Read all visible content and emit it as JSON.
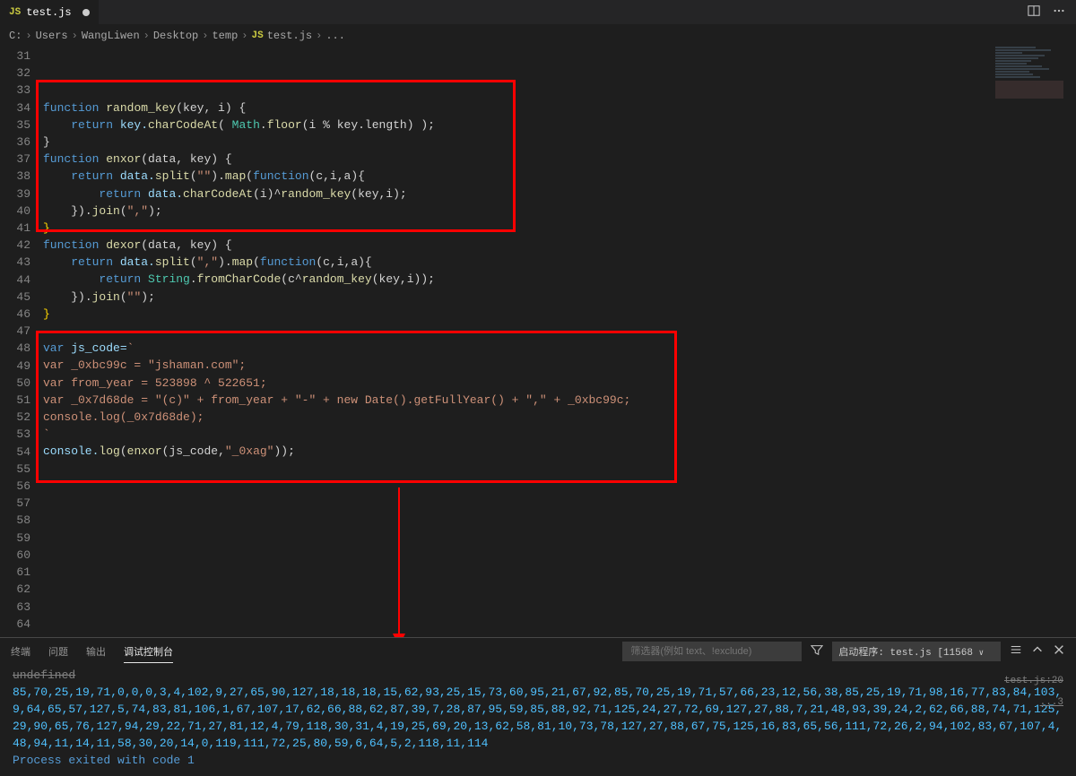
{
  "tab": {
    "icon": "JS",
    "filename": "test.js"
  },
  "breadcrumb": {
    "parts": [
      "C:",
      "Users",
      "WangLiwen",
      "Desktop",
      "temp"
    ],
    "fileIcon": "JS",
    "file": "test.js",
    "trailing": "..."
  },
  "editor": {
    "startLine": 31,
    "endLine": 64
  },
  "code": {
    "l34_fn": "function",
    "l34_name": "random_key",
    "l34_params": "(key, i) {",
    "l35_ret": "return",
    "l35_a": " key.",
    "l35_b": "charCodeAt",
    "l35_c": "( ",
    "l35_d": "Math",
    "l35_e": ".",
    "l35_f": "floor",
    "l35_g": "(i % key.length) );",
    "l36": "}",
    "l37_fn": "function",
    "l37_name": "enxor",
    "l37_params": "(data, key) {",
    "l38_ret": "return",
    "l38_a": " data.",
    "l38_b": "split",
    "l38_c": "(",
    "l38_d": "\"\"",
    "l38_e": ").",
    "l38_f": "map",
    "l38_g": "(",
    "l38_h": "function",
    "l38_i": "(c,i,a){",
    "l39_ret": "return",
    "l39_a": " data.",
    "l39_b": "charCodeAt",
    "l39_c": "(i)^",
    "l39_d": "random_key",
    "l39_e": "(key,i);",
    "l40_a": "}).",
    "l40_b": "join",
    "l40_c": "(",
    "l40_d": "\",\"",
    "l40_e": ");",
    "l41": "}",
    "l42_fn": "function",
    "l42_name": "dexor",
    "l42_params": "(data, key) {",
    "l43_ret": "return",
    "l43_a": " data.",
    "l43_b": "split",
    "l43_c": "(",
    "l43_d": "\",\"",
    "l43_e": ").",
    "l43_f": "map",
    "l43_g": "(",
    "l43_h": "function",
    "l43_i": "(c,i,a){",
    "l44_ret": "return",
    "l44_a": " ",
    "l44_b": "String",
    "l44_c": ".",
    "l44_d": "fromCharCode",
    "l44_e": "(c^",
    "l44_f": "random_key",
    "l44_g": "(key,i));",
    "l45_a": "}).",
    "l45_b": "join",
    "l45_c": "(",
    "l45_d": "\"\"",
    "l45_e": ");",
    "l46": "}",
    "l48_var": "var",
    "l48_a": " js_code=",
    "l48_b": "`",
    "l49_var": "var",
    "l49_a": " _0xbc99c = ",
    "l49_b": "\"jshaman.com\"",
    "l49_c": ";",
    "l50_var": "var",
    "l50_a": " from_year = ",
    "l50_b": "523898",
    "l50_c": " ^ ",
    "l50_d": "522651",
    "l50_e": ";",
    "l51_var": "var",
    "l51_a": " _0x7d68de = ",
    "l51_b": "\"(c)\"",
    "l51_c": " + from_year + ",
    "l51_d": "\"-\"",
    "l51_e": " + ",
    "l51_f": "new",
    "l51_g": " ",
    "l51_h": "Date",
    "l51_i": "().",
    "l51_j": "getFullYear",
    "l51_k": "() + ",
    "l51_l": "\",\"",
    "l51_m": " + _0xbc99c;",
    "l52_a": "console.",
    "l52_b": "log",
    "l52_c": "(_0x7d68de);",
    "l53": "`",
    "l54_a": "console.",
    "l54_b": "log",
    "l54_c": "(",
    "l54_d": "enxor",
    "l54_e": "(js_code,",
    "l54_f": "\"_0xag\"",
    "l54_g": "));"
  },
  "panel": {
    "tabs": {
      "terminal": "终端",
      "problems": "问题",
      "output": "输出",
      "debugConsole": "调试控制台"
    },
    "filterPlaceholder": "筛选器(例如 text、!exclude)",
    "launchLabel": "启动程序: test.js [11568",
    "undefined": "undefined",
    "sourceLink": "test.js:20",
    "cornerLink": "...3",
    "output": "85,70,25,19,71,0,0,0,3,4,102,9,27,65,90,127,18,18,18,15,62,93,25,15,73,60,95,21,67,92,85,70,25,19,71,57,66,23,12,56,38,85,25,19,71,98,16,77,83,84,103,9,64,65,57,127,5,74,83,81,106,1,67,107,17,62,66,88,62,87,39,7,28,87,95,59,85,88,92,71,125,24,27,72,69,127,27,88,7,21,48,93,39,24,2,62,66,88,74,71,125,29,90,65,76,127,94,29,22,71,27,81,12,4,79,118,30,31,4,19,25,69,20,13,62,58,81,10,73,78,127,27,88,67,75,125,16,83,65,56,111,72,26,2,94,102,83,67,107,4,48,94,11,14,11,58,30,20,14,0,119,111,72,25,80,59,6,64,5,2,118,11,114",
    "exitMsg": "Process exited with code 1"
  }
}
